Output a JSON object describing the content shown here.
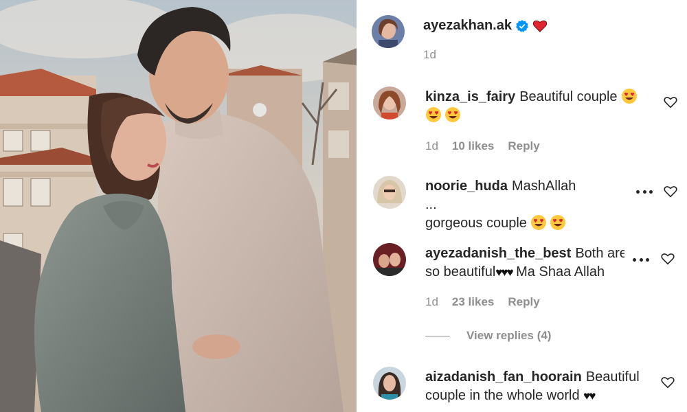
{
  "caption": {
    "username": "ayezakhan.ak",
    "verified_icon": "verified-badge-icon",
    "emoji": "red-heart-icon",
    "time": "1d"
  },
  "comments": [
    {
      "username": "kinza_is_fairy",
      "text": "Beautiful couple",
      "emojis": [
        "heart-eyes",
        "heart-eyes",
        "heart-eyes"
      ],
      "time": "1d",
      "likes": "10 likes",
      "reply_label": "Reply"
    },
    {
      "username": "noorie_huda",
      "text": "MashAllah ...",
      "text2": "gorgeous couple",
      "emojis": [
        "heart-eyes",
        "heart-eyes"
      ]
    },
    {
      "username": "ayezadanish_the_best",
      "text": "Both are so",
      "text2": "so beautiful",
      "hearts": "♥♥♥",
      "text3": "Ma Shaa Allah",
      "time": "1d",
      "likes": "23 likes",
      "reply_label": "Reply"
    },
    {
      "username": "aizadanish_fan_hoorain",
      "text": "Beautiful",
      "text2": "couple in the whole world",
      "hearts": "♥♥"
    }
  ],
  "view_replies": "View replies (4)",
  "colors": {
    "text": "#262626",
    "muted": "#8e8e8e",
    "verified": "#0095f6",
    "heart": "#ed4956"
  }
}
